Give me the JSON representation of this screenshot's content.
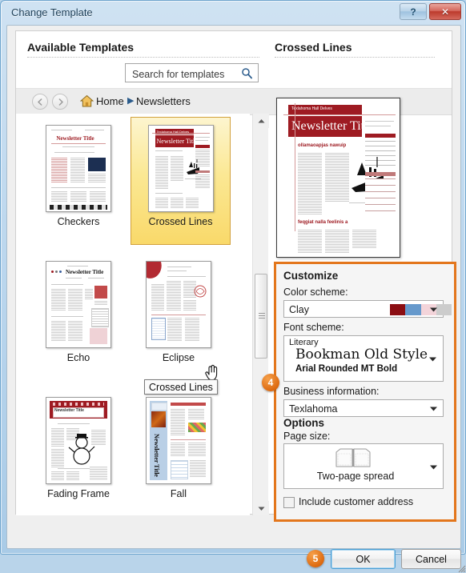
{
  "window": {
    "title": "Change Template",
    "help_button": "?",
    "close_button": "✕"
  },
  "left_panel": {
    "heading": "Available Templates",
    "search": {
      "placeholder": "Search for templates",
      "value": "",
      "icon": "search-icon"
    },
    "breadcrumb": {
      "back_icon": "arrow-left-icon",
      "forward_icon": "arrow-right-icon",
      "home_icon": "home-icon",
      "home_label": "Home",
      "separator": "▶",
      "current": "Newsletters"
    },
    "templates": [
      {
        "name": "Checkers",
        "selected": false
      },
      {
        "name": "Crossed Lines",
        "selected": true
      },
      {
        "name": "Echo",
        "selected": false
      },
      {
        "name": "Eclipse",
        "selected": false
      },
      {
        "name": "Fading Frame",
        "selected": false
      },
      {
        "name": "Fall",
        "selected": false
      }
    ],
    "tooltip": "Crossed Lines",
    "scrollbar": {
      "up_arrow": "▲",
      "down_arrow": "▼"
    }
  },
  "right_panel": {
    "heading": "Crossed Lines",
    "preview_title": "Newsletter Title",
    "preview_masthead": "Texlahoma Hall Delves",
    "customize": {
      "title": "Customize",
      "color_scheme_label": "Color scheme:",
      "color_scheme_value": "Clay",
      "color_scheme_swatches": [
        "#8B0D12",
        "#6699CC",
        "#F3D4DA",
        "#CCCCCC"
      ],
      "font_scheme_label": "Font scheme:",
      "font_scheme_name": "Literary",
      "font_scheme_heading_font": "Bookman Old Style",
      "font_scheme_body_font": "Arial Rounded MT Bold",
      "business_info_label": "Business information:",
      "business_info_value": "Texlahoma"
    },
    "options": {
      "title": "Options",
      "page_size_label": "Page size:",
      "page_size_value": "Two-page spread",
      "page_size_icon": "two-page-spread-icon",
      "include_address_label": "Include customer address",
      "include_address_checked": false
    }
  },
  "callouts": {
    "step4": "4",
    "step5": "5"
  },
  "footer": {
    "ok_label": "OK",
    "cancel_label": "Cancel"
  },
  "colors": {
    "accent_orange": "#E3761C",
    "selection_gold": "#FBE894",
    "titlebar_blue": "#BCD7EE"
  }
}
